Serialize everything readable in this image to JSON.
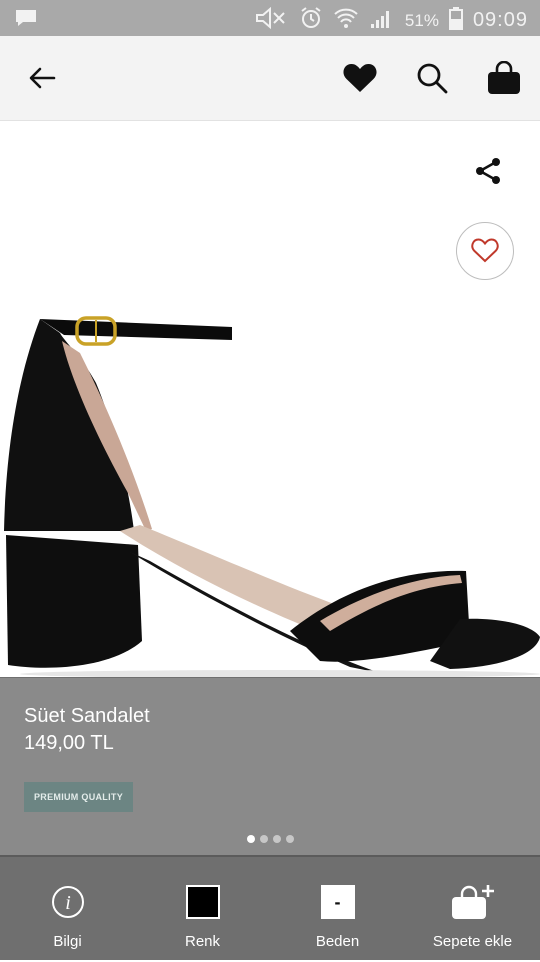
{
  "status_bar": {
    "battery": "51%",
    "time": "09:09",
    "icons": [
      "message-icon",
      "mute-icon",
      "alarm-icon",
      "wifi-icon",
      "signal-icon",
      "battery-icon"
    ]
  },
  "app_bar": {
    "icons": [
      "back-arrow-icon",
      "wishlist-heart-icon",
      "search-icon",
      "shopping-bag-icon"
    ]
  },
  "product": {
    "name": "Süet Sandalet",
    "price": "149,00 TL",
    "badge": "PREMIUM QUALITY",
    "image_pages": 4,
    "active_page": 1
  },
  "bottom_bar": {
    "items": [
      {
        "label": "Bilgi",
        "icon": "info-icon"
      },
      {
        "label": "Renk",
        "icon": "color-swatch-icon",
        "swatch_color": "#000000"
      },
      {
        "label": "Beden",
        "icon": "size-icon",
        "value": "-"
      },
      {
        "label": "Sepete ekle",
        "icon": "add-to-bag-icon"
      }
    ]
  },
  "colors": {
    "status_bar": "#a9a9a9",
    "app_bar": "#f3f3f3",
    "info_panel": "#8a8a8a",
    "bottom_bar": "#6f6f6f",
    "badge": "#6c8583",
    "fav_heart": "#c0392b"
  }
}
